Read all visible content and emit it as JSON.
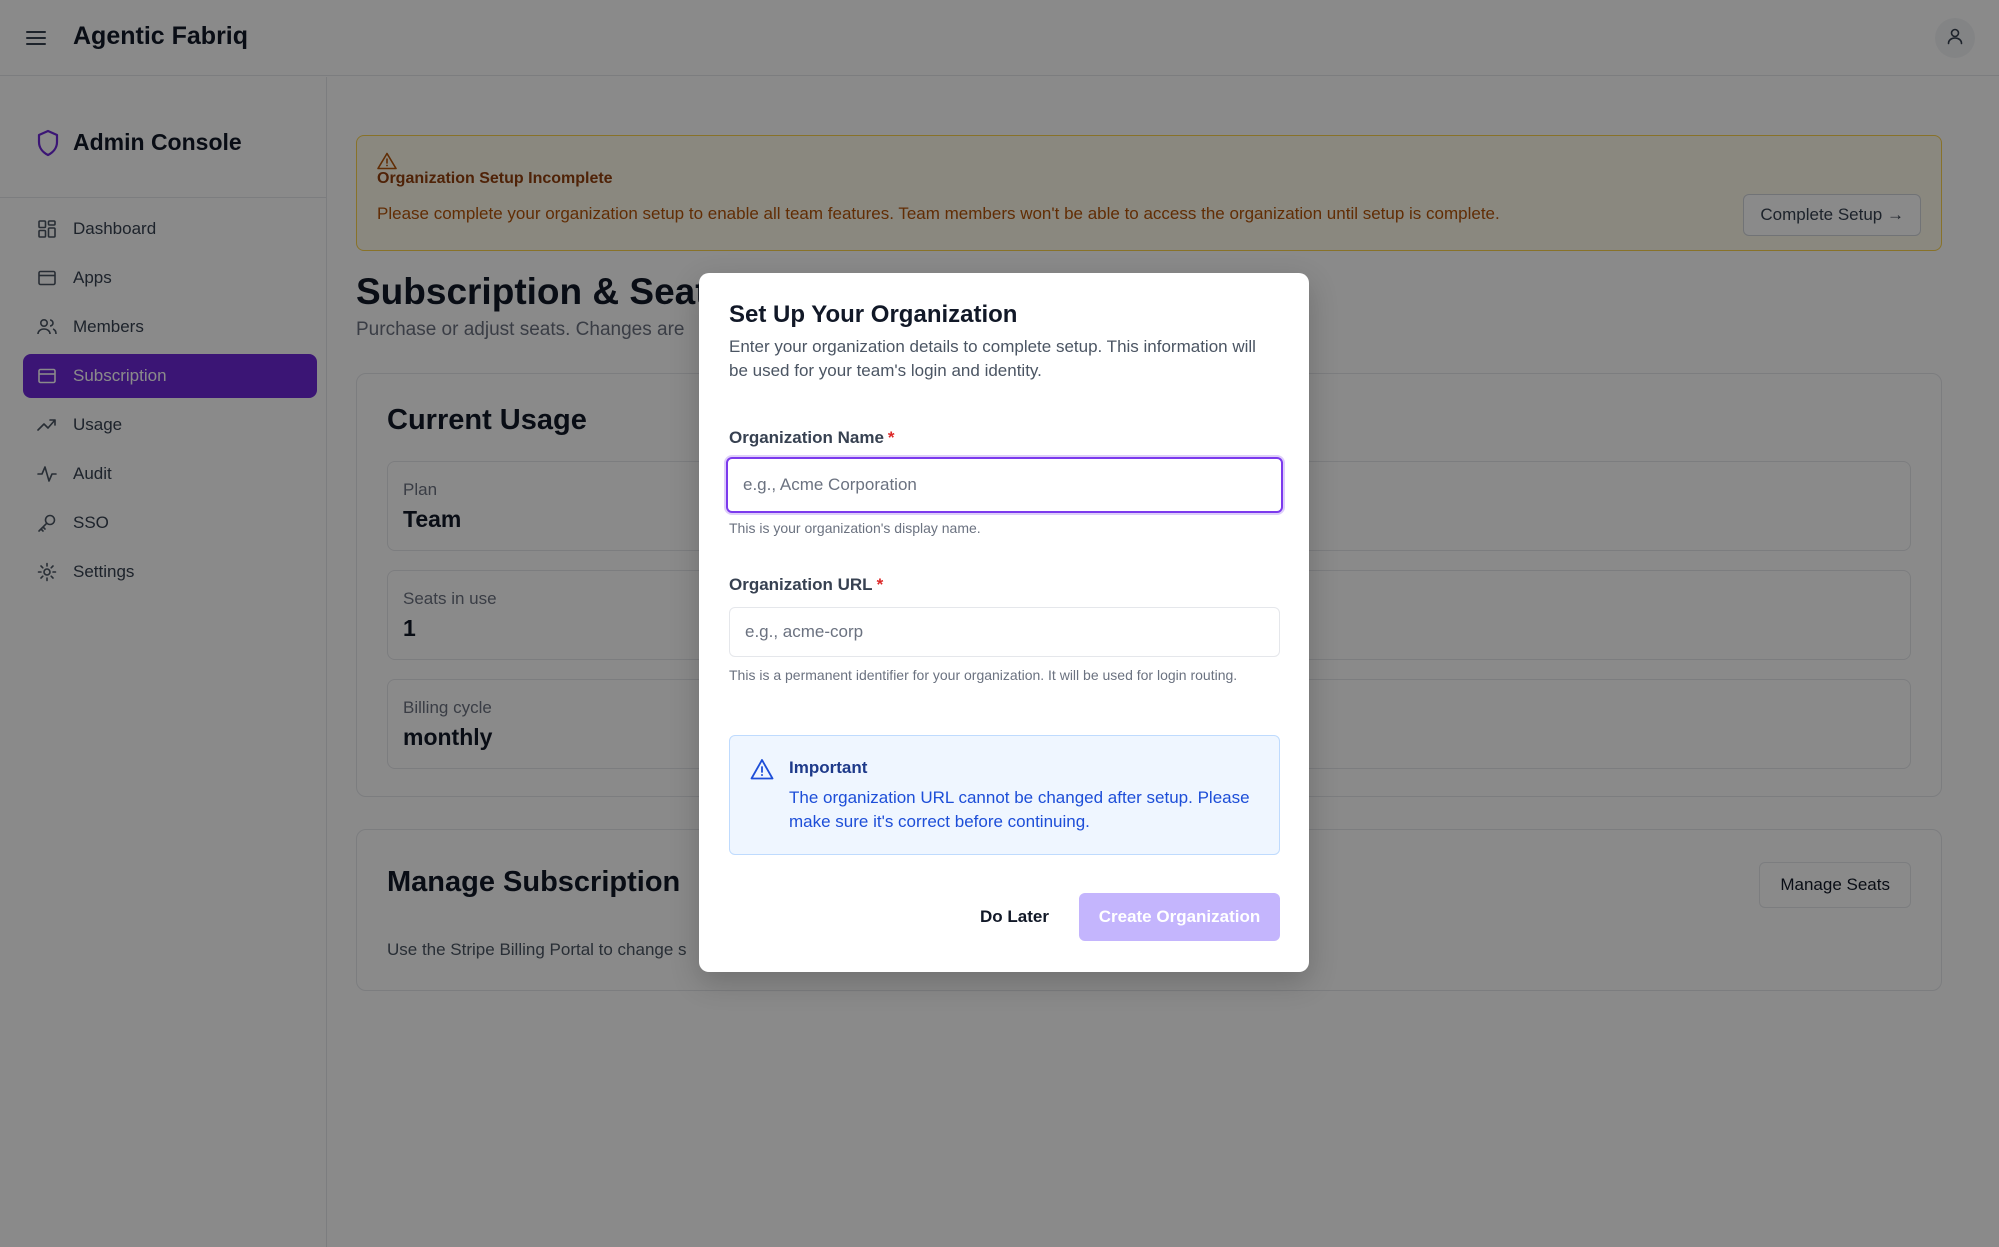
{
  "app": {
    "title": "Agentic Fabriq"
  },
  "sidebar": {
    "title": "Admin Console",
    "items": [
      {
        "label": "Dashboard",
        "icon": "grid-icon"
      },
      {
        "label": "Apps",
        "icon": "window-icon"
      },
      {
        "label": "Members",
        "icon": "users-icon"
      },
      {
        "label": "Subscription",
        "icon": "credit-card-icon",
        "active": true
      },
      {
        "label": "Usage",
        "icon": "trending-up-icon"
      },
      {
        "label": "Audit",
        "icon": "activity-icon"
      },
      {
        "label": "SSO",
        "icon": "key-icon"
      },
      {
        "label": "Settings",
        "icon": "gear-icon"
      }
    ]
  },
  "banner": {
    "title": "Organization Setup Incomplete",
    "text": "Please complete your organization setup to enable all team features. Team members won't be able to access the organization until setup is complete.",
    "button": "Complete Setup →"
  },
  "page": {
    "title": "Subscription & Seats",
    "subtitle": "Purchase or adjust seats. Changes are"
  },
  "usage": {
    "title": "Current Usage",
    "stats": [
      {
        "label": "Plan",
        "value": "Team"
      },
      {
        "label": "Seats in use",
        "value": "1"
      },
      {
        "label": "Billing cycle",
        "value": "monthly"
      }
    ]
  },
  "manage": {
    "title": "Manage Subscription",
    "text": "Use the Stripe Billing Portal to change s",
    "button": "Manage Seats"
  },
  "modal": {
    "title": "Set Up Your Organization",
    "description": "Enter your organization details to complete setup. This information will be used for your team's login and identity.",
    "org_name": {
      "label": "Organization Name",
      "required": "*",
      "placeholder": "e.g., Acme Corporation",
      "value": "",
      "help": "This is your organization's display name."
    },
    "org_url": {
      "label": "Organization URL",
      "required": "*",
      "placeholder": "e.g., acme-corp",
      "value": "",
      "help": "This is a permanent identifier for your organization. It will be used for login routing."
    },
    "alert": {
      "title": "Important",
      "text": "The organization URL cannot be changed after setup. Please make sure it's correct before continuing."
    },
    "later_button": "Do Later",
    "create_button": "Create Organization"
  },
  "colors": {
    "accent": "#6d28d9",
    "accent_disabled": "#c4b5fd",
    "warning_bg": "#fffbeb",
    "info_bg": "#eff6ff"
  }
}
